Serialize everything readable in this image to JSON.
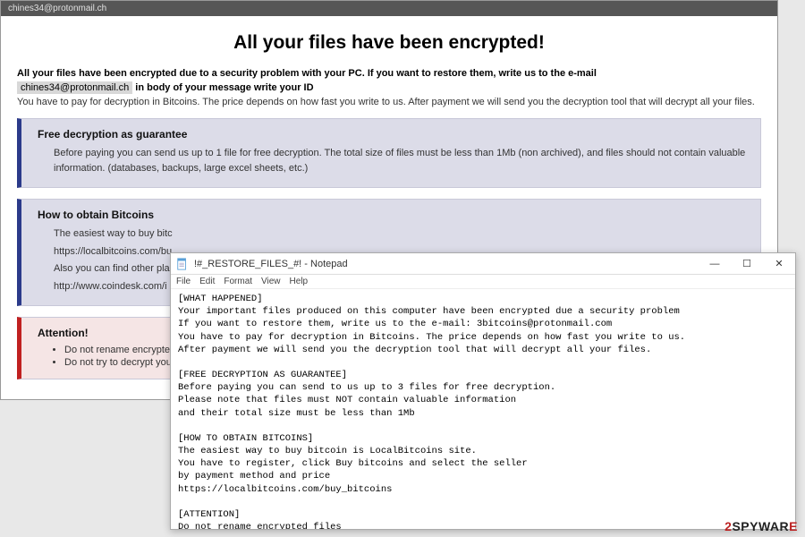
{
  "ransom_window": {
    "title": "chines34@protonmail.ch",
    "heading": "All your files have been encrypted!",
    "intro_bold": "All your files have been encrypted due to a security problem with your PC. If you want to restore them, write us to the e-mail",
    "email": "chines34@protonmail.ch",
    "intro_tail": " in body of your message write your ID",
    "pay_line": "You have to pay for decryption in Bitcoins. The price depends on how fast you write to us. After payment we will send you the decryption tool that will decrypt all your files.",
    "box1": {
      "title": "Free decryption as guarantee",
      "text": "Before paying you can send us up to 1 file for free decryption. The total size of files must be less than 1Mb (non archived), and files should not contain valuable information. (databases, backups, large excel sheets, etc.)"
    },
    "box2": {
      "title": "How to obtain Bitcoins",
      "line1": "The easiest way to buy bitc",
      "link1": "https://localbitcoins.com/bu",
      "line2": "Also you can find other plac",
      "link2": "http://www.coindesk.com/i"
    },
    "box3": {
      "title": "Attention!",
      "bullet1": "Do not rename encrypted f",
      "bullet2": "Do not try to decrypt your"
    }
  },
  "notepad": {
    "title": "!#_RESTORE_FILES_#! - Notepad",
    "menu": [
      "File",
      "Edit",
      "Format",
      "View",
      "Help"
    ],
    "body": "[WHAT HAPPENED]\nYour important files produced on this computer have been encrypted due a security problem\nIf you want to restore them, write us to the e-mail: 3bitcoins@protonmail.com\nYou have to pay for decryption in Bitcoins. The price depends on how fast you write to us.\nAfter payment we will send you the decryption tool that will decrypt all your files.\n\n[FREE DECRYPTION AS GUARANTEE]\nBefore paying you can send to us up to 3 files for free decryption.\nPlease note that files must NOT contain valuable information\nand their total size must be less than 1Mb\n\n[HOW TO OBTAIN BITCOINS]\nThe easiest way to buy bitcoin is LocalBitcoins site.\nYou have to register, click Buy bitcoins and select the seller\nby payment method and price\nhttps://localbitcoins.com/buy_bitcoins\n\n[ATTENTION]\nDo not rename encrypted files\nDo not try to decrypt your data using third party software, it may cause permanent data loss\nIf you not write on e-mail in 36 hours - your key has been deleted and you cant decrypt your files\n\nYour ID:",
    "controls": {
      "min": "—",
      "max": "☐",
      "close": "✕"
    }
  },
  "watermark": {
    "two": "2",
    "spy": "SPYWAR",
    "e": "E"
  }
}
